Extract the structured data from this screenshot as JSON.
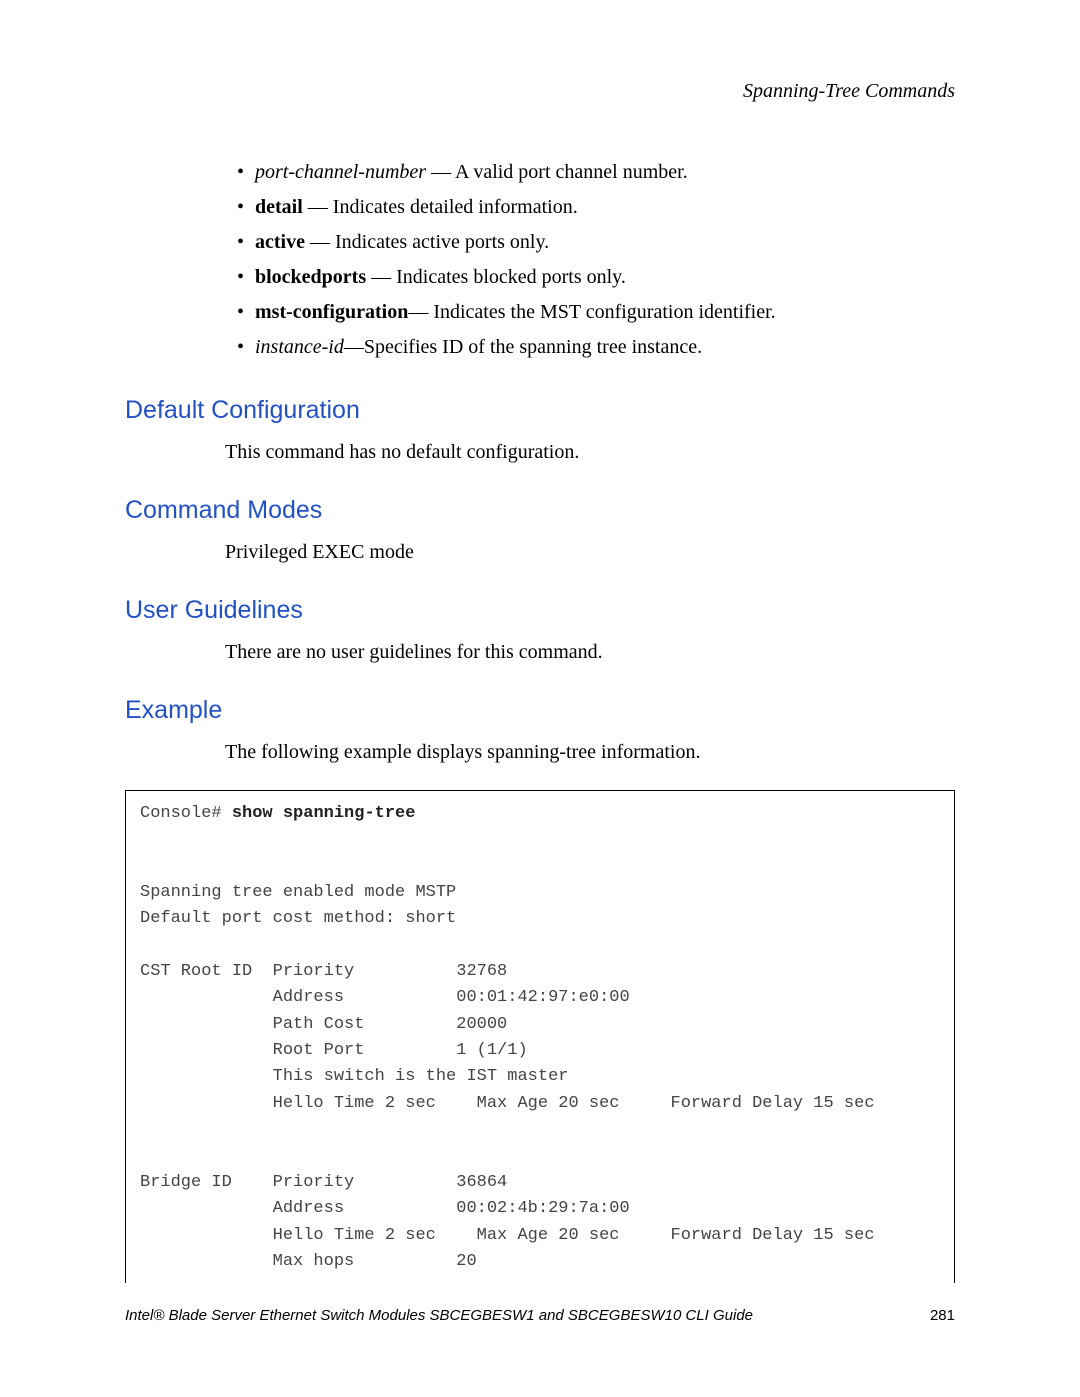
{
  "header": {
    "running": "Spanning-Tree Commands"
  },
  "bullets": [
    {
      "term": "port-channel-number",
      "style": "i",
      "sep": " — ",
      "desc": "A valid port channel number."
    },
    {
      "term": "detail",
      "style": "b",
      "sep": " — ",
      "desc": "Indicates detailed information."
    },
    {
      "term": "active",
      "style": "b",
      "sep": " — ",
      "desc": "Indicates active ports only."
    },
    {
      "term": "blockedports",
      "style": "b",
      "sep": " — ",
      "desc": "Indicates blocked ports only."
    },
    {
      "term": "mst-configuration",
      "style": "b",
      "sep": "— ",
      "desc": "Indicates the MST configuration identifier."
    },
    {
      "term": "instance-id",
      "style": "i",
      "sep": "—",
      "desc": "Specifies ID of the spanning tree instance."
    }
  ],
  "sections": {
    "defcfg": {
      "title": "Default Configuration",
      "body": "This command has no default configuration."
    },
    "cmdmodes": {
      "title": "Command Modes",
      "body": "Privileged EXEC mode"
    },
    "userg": {
      "title": "User Guidelines",
      "body": "There are no user guidelines for this command."
    },
    "example": {
      "title": "Example",
      "body": "The following example displays spanning-tree information."
    }
  },
  "code": {
    "prompt": "Console# ",
    "command": "show spanning-tree",
    "lines": [
      "",
      "",
      "Spanning tree enabled mode MSTP",
      "Default port cost method: short",
      "",
      "CST Root ID  Priority          32768",
      "             Address           00:01:42:97:e0:00",
      "             Path Cost         20000",
      "             Root Port         1 (1/1)",
      "             This switch is the IST master",
      "             Hello Time 2 sec    Max Age 20 sec     Forward Delay 15 sec",
      "",
      "",
      "Bridge ID    Priority          36864",
      "             Address           00:02:4b:29:7a:00",
      "             Hello Time 2 sec    Max Age 20 sec     Forward Delay 15 sec",
      "             Max hops          20"
    ]
  },
  "footer": {
    "text": "Intel® Blade Server Ethernet Switch Modules SBCEGBESW1 and SBCEGBESW10 CLI Guide",
    "page": "281"
  }
}
